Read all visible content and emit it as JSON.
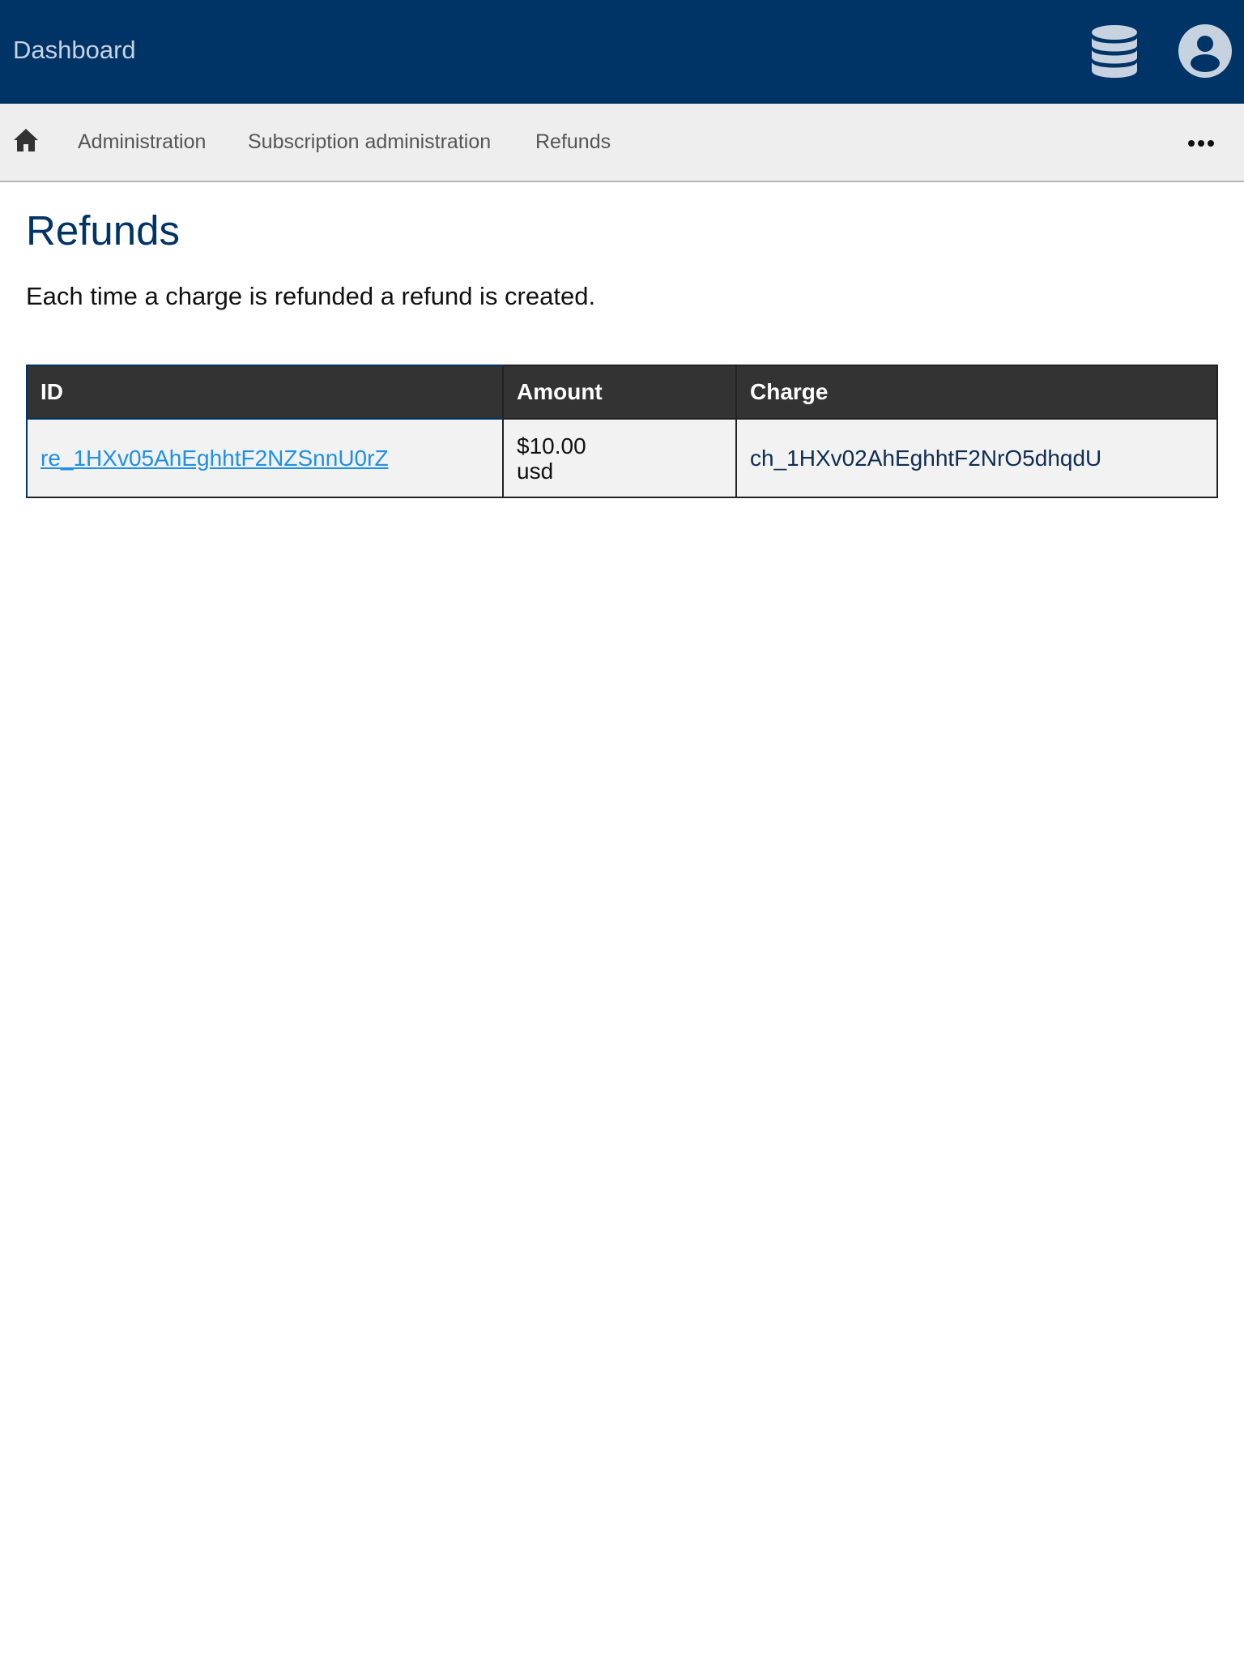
{
  "header": {
    "brand": "Dashboard",
    "icons": {
      "database": "database-icon",
      "account": "user-circle-icon"
    },
    "colors": {
      "background": "#003366",
      "icon": "#c6d2e0"
    }
  },
  "nav": {
    "home_icon": "home-icon",
    "items": [
      {
        "label": "Administration"
      },
      {
        "label": "Subscription administration"
      },
      {
        "label": "Refunds"
      }
    ],
    "more_icon": "ellipsis-icon"
  },
  "main": {
    "title": "Refunds",
    "description": "Each time a charge is refunded a refund is created.",
    "table": {
      "columns": [
        "ID",
        "Amount",
        "Charge"
      ],
      "rows": [
        {
          "id": "re_1HXv05AhEghhtF2NZSnnU0rZ",
          "amount": "$10.00",
          "currency": "usd",
          "charge": "ch_1HXv02AhEghhtF2NrO5dhqdU"
        }
      ]
    }
  }
}
